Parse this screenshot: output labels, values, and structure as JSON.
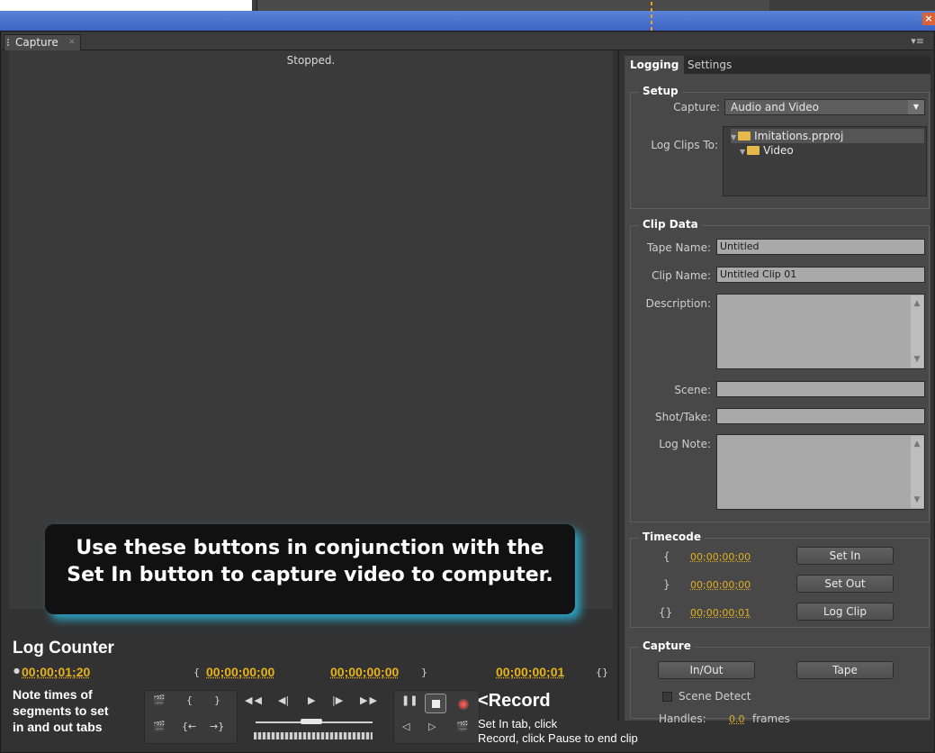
{
  "window": {
    "panel_tab": "Capture",
    "status": "Stopped."
  },
  "tabs": {
    "logging": "Logging",
    "settings": "Settings"
  },
  "setup": {
    "title": "Setup",
    "capture_label": "Capture:",
    "capture_value": "Audio and Video",
    "log_clips_label": "Log Clips To:",
    "tree": [
      "Imitations.prproj",
      "Video"
    ]
  },
  "clip_data": {
    "title": "Clip Data",
    "tape_name_label": "Tape Name:",
    "tape_name": "Untitled",
    "clip_name_label": "Clip Name:",
    "clip_name": "Untitled Clip 01",
    "description_label": "Description:",
    "scene_label": "Scene:",
    "shot_take_label": "Shot/Take:",
    "log_note_label": "Log Note:"
  },
  "timecode": {
    "title": "Timecode",
    "in": "00;00;00;00",
    "out": "00;00;00;00",
    "duration": "00;00;00;01",
    "set_in": "Set In",
    "set_out": "Set Out",
    "log_clip": "Log Clip"
  },
  "capture_group": {
    "title": "Capture",
    "in_out": "In/Out",
    "tape": "Tape",
    "scene_detect": "Scene Detect",
    "handles_label": "Handles:",
    "handles_value": "0.0",
    "frames": "frames"
  },
  "callout": {
    "line1": "Use these buttons in conjunction with the",
    "line2": "Set In button to capture video to computer."
  },
  "annotations": {
    "log_counter": "Log Counter",
    "note_line1": "Note times of",
    "note_line2": "segments to set",
    "note_line3": "in and out tabs",
    "record": "<Record",
    "record_note1": "Set In tab, click",
    "record_note2": "Record, click Pause to end clip"
  },
  "counters": {
    "current": "00;00;01;20",
    "in": "00;00;00;00",
    "out": "00;00;00;00",
    "duration": "00;00;00;01"
  },
  "colors": {
    "accent_timecode": "#e0b020",
    "callout_shadow": "#2aa6c7",
    "titlebar": "#4b73cf"
  }
}
